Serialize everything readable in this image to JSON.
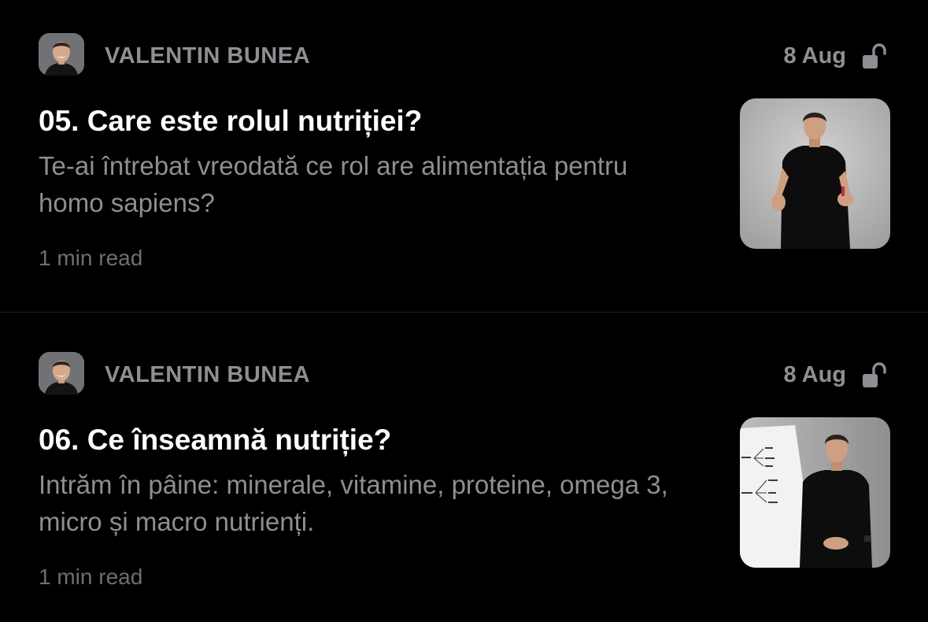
{
  "feed": {
    "posts": [
      {
        "author": "VALENTIN BUNEA",
        "date": "8 Aug",
        "title": "05. Care este rolul nutriției?",
        "description": "Te-ai întrebat vreodată ce rol are alimentația pentru homo sapiens?",
        "read_time": "1 min read",
        "lock_icon": "unlocked-padlock-icon",
        "thumbnail": "video-thumbnail-man-speaking"
      },
      {
        "author": "VALENTIN BUNEA",
        "date": "8 Aug",
        "title": "06. Ce înseamnă nutriție?",
        "description": "Intrăm în pâine: minerale, vitamine, proteine, omega 3, micro și macro nutrienți.",
        "read_time": "1 min read",
        "lock_icon": "unlocked-padlock-icon",
        "thumbnail": "video-thumbnail-man-whiteboard"
      }
    ]
  },
  "colors": {
    "background": "#000000",
    "title": "#ffffff",
    "secondary_text": "#8e8e93",
    "divider": "#1c1c24"
  }
}
